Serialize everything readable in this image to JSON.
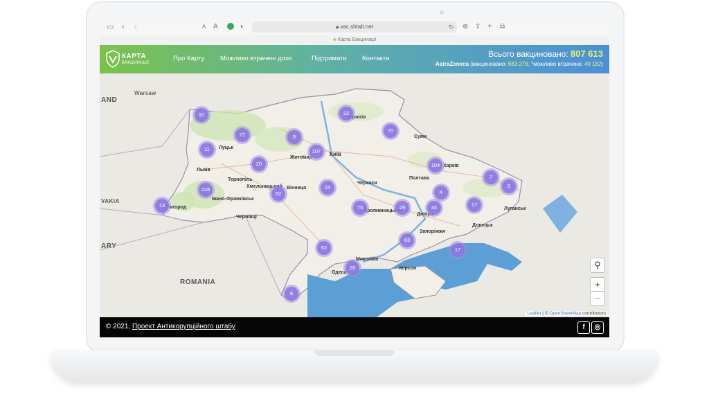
{
  "browser": {
    "url": "vac.shtab.net",
    "tab_title": "Карта Вакцинації",
    "icons": [
      "sidebar-icon",
      "back-icon",
      "forward-icon",
      "text-size-icon",
      "extension-icon",
      "shield-icon",
      "lock-icon",
      "reload-icon",
      "download-icon",
      "share-icon",
      "new-tab-icon",
      "tabs-icon"
    ]
  },
  "header": {
    "logo_title": "КАРТА",
    "logo_subtitle": "ВАКЦИНАЦІЇ",
    "nav": [
      "Про Карту",
      "Можливо втрачені дози",
      "Підтримати",
      "Контакти"
    ],
    "total_label": "Всього вакциновано:",
    "total_value": "807 613",
    "vaccine_name": "AstraZeneca",
    "vaccinated_label": "(вакциновано:",
    "vaccinated_value": "683 278",
    "lost_label": ", *можливо втрачено:",
    "lost_value": "49 182",
    "lost_close": ")"
  },
  "map": {
    "countries": [
      "Warsaw",
      "AND",
      "VAKIA",
      "ARY",
      "ROMANIA"
    ],
    "cities": [
      "Луцьк",
      "Львів",
      "Тернопіль",
      "Житомир",
      "Київ",
      "Вінниця",
      "Хмельницький",
      "Івано-Франківськ",
      "Чернівці",
      "Ужгород",
      "Черкаси",
      "Суми",
      "Харків",
      "Полтава",
      "Кропивницький",
      "Дніпро",
      "Запоріжжя",
      "Донецьк",
      "Луганськ",
      "Миколаїв",
      "Одеса",
      "Херсон",
      "Чернігів"
    ],
    "clusters": [
      "10",
      "22",
      "77",
      "9",
      "70",
      "11",
      "107",
      "20",
      "104",
      "7",
      "5",
      "228",
      "52",
      "24",
      "4",
      "13",
      "75",
      "29",
      "44",
      "17",
      "63",
      "62",
      "17",
      "26",
      "8"
    ],
    "zoom_in": "+",
    "zoom_out": "−",
    "attribution_leaflet": "Leaflet",
    "attribution_sep": " | © ",
    "attribution_osm": "OpenStreetMap",
    "attribution_tail": " contributors"
  },
  "footer": {
    "copyright": "© 2021, ",
    "project_link": "Проект Антикорупційного штабу",
    "facebook": "f",
    "instagram": "◎"
  },
  "colors": {
    "header_gradient_start": "#7bc24a",
    "header_gradient_end": "#4d8fd9",
    "highlight": "#e3f56b",
    "cluster": "#8974e0",
    "sea": "#5b9fd5",
    "footer_bg": "#050505"
  }
}
